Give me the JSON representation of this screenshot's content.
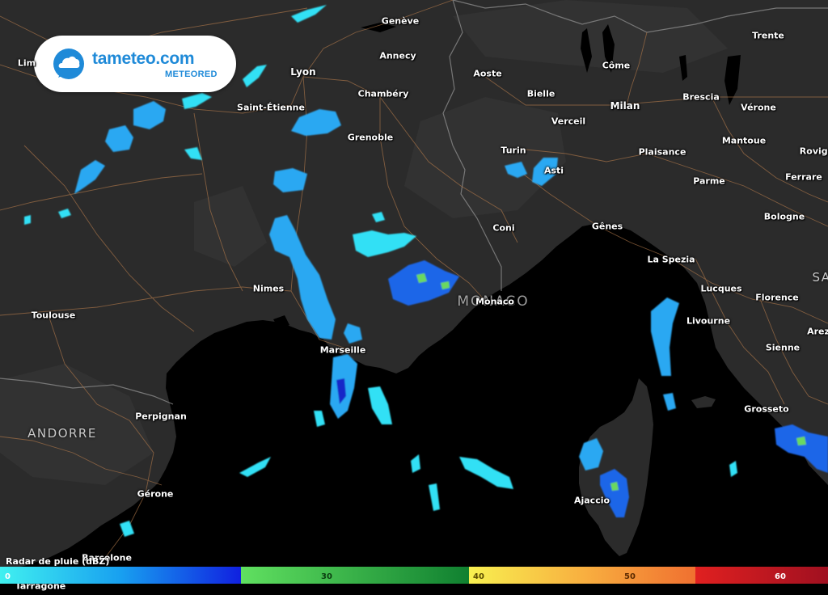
{
  "brand": {
    "name": "tameteo.com",
    "sub": "METEORED",
    "color": "#1f8ad8"
  },
  "map": {
    "land_color": "#2b2b2b",
    "sea_color": "#000000",
    "road_color": "#b0784a",
    "border_color": "#8a8a8a",
    "radar_colors": [
      "#33e0f5",
      "#2aa8f2",
      "#1e66e8",
      "#1428c8",
      "#6ad860",
      "#2ea838"
    ]
  },
  "cities": [
    {
      "id": "geneve",
      "name": "Genève"
    },
    {
      "id": "trente",
      "name": "Trente"
    },
    {
      "id": "lim",
      "name": "Lim"
    },
    {
      "id": "annecy",
      "name": "Annecy"
    },
    {
      "id": "aoste",
      "name": "Aoste"
    },
    {
      "id": "come",
      "name": "Côme"
    },
    {
      "id": "lyon",
      "name": "Lyon"
    },
    {
      "id": "brescia",
      "name": "Brescia"
    },
    {
      "id": "verone",
      "name": "Vérone"
    },
    {
      "id": "chambery",
      "name": "Chambéry"
    },
    {
      "id": "bielle",
      "name": "Bielle"
    },
    {
      "id": "milan",
      "name": "Milan"
    },
    {
      "id": "saint-etienne",
      "name": "Saint-Étienne"
    },
    {
      "id": "verceil",
      "name": "Verceil"
    },
    {
      "id": "grenoble",
      "name": "Grenoble"
    },
    {
      "id": "mantoue",
      "name": "Mantoue"
    },
    {
      "id": "rovigo",
      "name": "Rovigo"
    },
    {
      "id": "turin",
      "name": "Turin"
    },
    {
      "id": "plaisance",
      "name": "Plaisance"
    },
    {
      "id": "asti",
      "name": "Asti"
    },
    {
      "id": "ferrare",
      "name": "Ferrare"
    },
    {
      "id": "parme",
      "name": "Parme"
    },
    {
      "id": "bologne",
      "name": "Bologne"
    },
    {
      "id": "genes",
      "name": "Gênes"
    },
    {
      "id": "coni",
      "name": "Coni"
    },
    {
      "id": "la-spezia",
      "name": "La Spezia"
    },
    {
      "id": "lucques",
      "name": "Lucques"
    },
    {
      "id": "nimes",
      "name": "Nimes"
    },
    {
      "id": "monaco",
      "name": "Monaco"
    },
    {
      "id": "florence",
      "name": "Florence"
    },
    {
      "id": "toulouse",
      "name": "Toulouse"
    },
    {
      "id": "livourne",
      "name": "Livourne"
    },
    {
      "id": "arezzo",
      "name": "Arez"
    },
    {
      "id": "marseille",
      "name": "Marseille"
    },
    {
      "id": "sienne",
      "name": "Sienne"
    },
    {
      "id": "perpignan",
      "name": "Perpignan"
    },
    {
      "id": "grosseto",
      "name": "Grosseto"
    },
    {
      "id": "gerone",
      "name": "Gérone"
    },
    {
      "id": "ajaccio",
      "name": "Ajaccio"
    },
    {
      "id": "barcelone",
      "name": "Barcelone"
    },
    {
      "id": "tarragone",
      "name": "Tarragone"
    }
  ],
  "countries": [
    {
      "id": "andorre",
      "name": "ANDORRE"
    },
    {
      "id": "monaco-country",
      "name": "MONACO"
    },
    {
      "id": "san-marino",
      "name": "SA"
    }
  ],
  "legend": {
    "title": "Radar de pluie (dBZ)",
    "ticks": [
      {
        "label": "0",
        "value": 0
      },
      {
        "label": "30",
        "value": 30
      },
      {
        "label": "40",
        "value": 40
      },
      {
        "label": "50",
        "value": 50
      },
      {
        "label": "60",
        "value": 60
      }
    ],
    "bands": [
      {
        "colors": [
          "#40f0f0",
          "#18a0f0",
          "#1020e0"
        ]
      },
      {
        "colors": [
          "#60e060",
          "#108030"
        ]
      },
      {
        "colors": [
          "#f8f050",
          "#f8b040",
          "#f07030"
        ]
      },
      {
        "colors": [
          "#e02020",
          "#a01020"
        ]
      }
    ]
  }
}
